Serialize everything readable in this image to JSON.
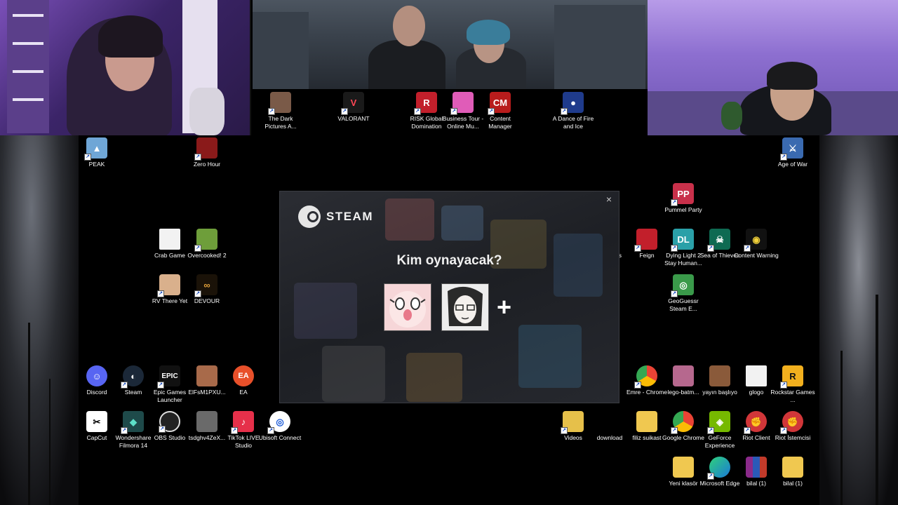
{
  "banner_icons": [
    {
      "label": "The Dark Pictures A...",
      "icon": "dark-pictures-icon",
      "color": "#7a5a48"
    },
    {
      "label": "VALORANT",
      "icon": "valorant-icon",
      "color": "#1a1a1a"
    },
    {
      "label": "RISK Global Domination",
      "icon": "risk-icon",
      "color": "#c21f2b"
    },
    {
      "label": "Business Tour - Online Mu...",
      "icon": "business-tour-icon",
      "color": "#e05cb8"
    },
    {
      "label": "Content Manager",
      "icon": "content-manager-icon",
      "color": "#b81c1c"
    },
    {
      "label": "A Dance of Fire and Ice",
      "icon": "dance-of-fire-icon",
      "color": "#1f3b8c"
    }
  ],
  "desktop_icons": {
    "peak": "PEAK",
    "zero_hour": "Zero Hour",
    "age_of_war": "Age of War",
    "pummel_party": "Pummel Party",
    "crab_game": "Crab Game",
    "overcooked": "Overcooked! 2",
    "rv_there_yet": "RV There Yet",
    "devour": "DEVOUR",
    "us_partial": "Us",
    "feign": "Feign",
    "dying_light": "Dying Light 2 Stay Human...",
    "sea_of_thieves": "Sea of Thieves",
    "content_warning": "Content Warning",
    "geoguessr": "GeoGuessr Steam E...",
    "discord": "Discord",
    "steam": "Steam",
    "epic": "Epic Games Launcher",
    "elfs": "ElFsM1PXU...",
    "ea": "EA",
    "emre_chrome": "Emre - Chrome",
    "lego": "lego-batm...",
    "yayin": "yayın başlıyo",
    "glogo": "glogo",
    "rockstar": "Rockstar Games ...",
    "capcut": "CapCut",
    "filmora": "Wondershare Filmora 14",
    "obs": "OBS Studio",
    "tsdghv": "tsdghv4ZeX...",
    "tiktok": "TikTok LIVE Studio",
    "ubisoft": "Ubisoft Connect",
    "videos": "Videos",
    "download": "download",
    "filiz": "filiz suikast",
    "google_chrome": "Google Chrome",
    "geforce": "GeForce Experience",
    "riot_client": "Riot Client",
    "riot_istemcisi": "Riot İstemcisi",
    "yeni_klasor": "Yeni klasör",
    "edge": "Microsoft Edge",
    "bilal1": "bilal (1)",
    "bilal2": "bilal (1)"
  },
  "steam_dialog": {
    "brand": "STEAM",
    "question": "Kim oynayacak?",
    "close": "×",
    "add": "+"
  },
  "colors": {
    "steam_bg": "#1d1f24",
    "cam_purple": "#7a4fb8"
  }
}
